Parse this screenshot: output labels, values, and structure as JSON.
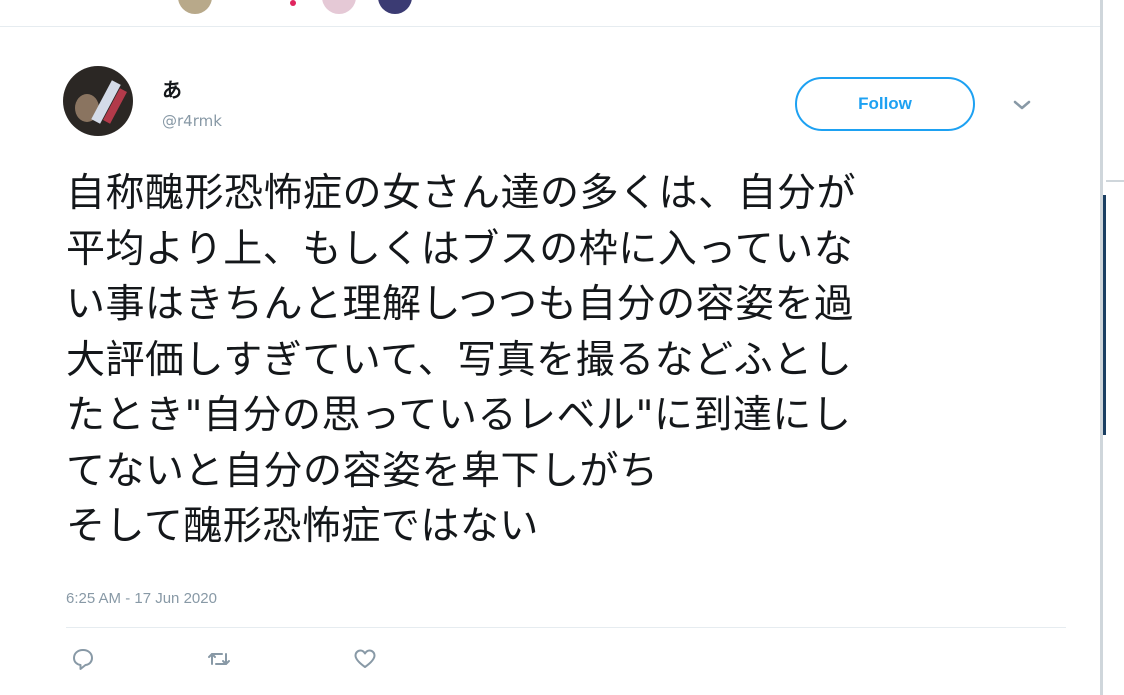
{
  "tweet": {
    "display_name": "あ",
    "handle": "@r4rmk",
    "follow_label": "Follow",
    "text_lines": [
      "自称醜形恐怖症の女さん達の多くは、自分が",
      "平均より上、もしくはブスの枠に入っていな",
      "い事はきちんと理解しつつも自分の容姿を過",
      "大評価しすぎていて、写真を撮るなどふとし",
      "たとき\"自分の思っているレベル\"に到達にし",
      "てないと自分の容姿を卑下しがち",
      "そして醜形恐怖症ではない"
    ],
    "timestamp": "6:25 AM - 17 Jun 2020"
  },
  "icons": {
    "reply": "reply-icon",
    "retweet": "retweet-icon",
    "like": "heart-icon",
    "more": "chevron-down-icon"
  },
  "colors": {
    "accent": "#1da1f2",
    "muted": "#8899a6",
    "text": "#14171a"
  }
}
